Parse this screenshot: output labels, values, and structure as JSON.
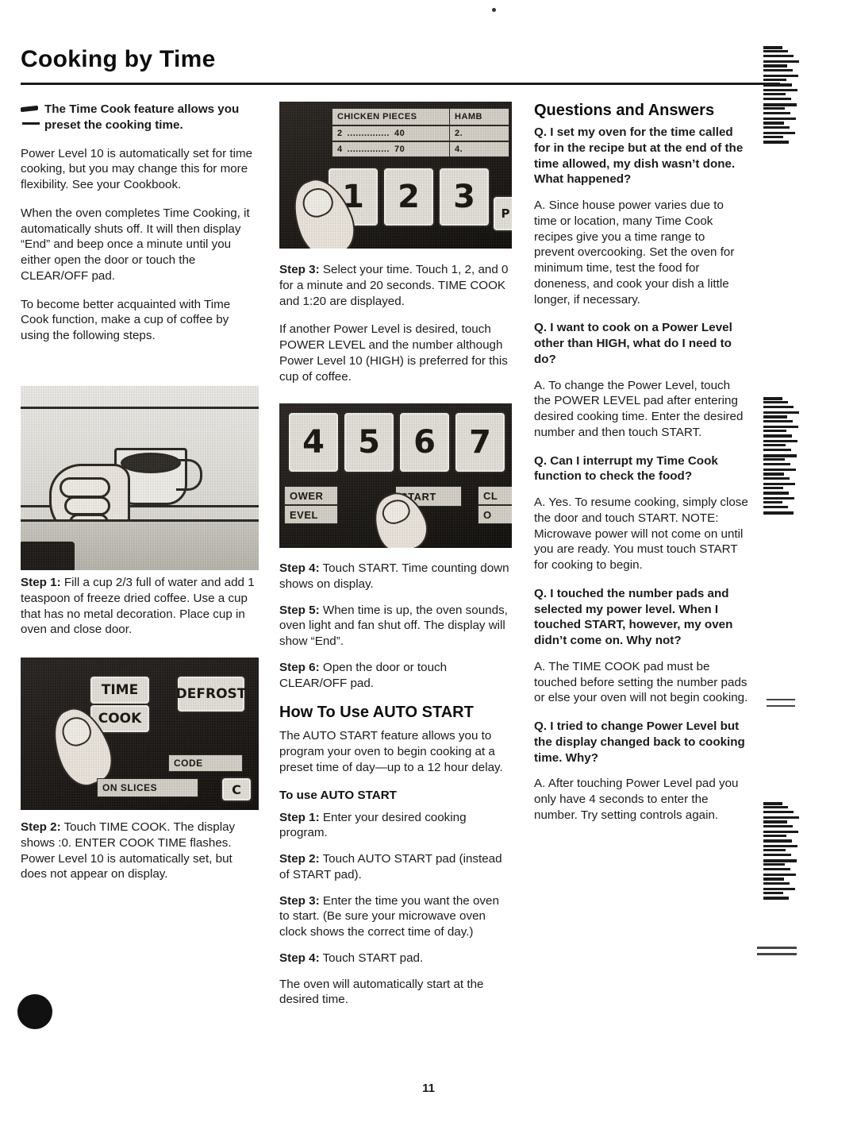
{
  "document": {
    "title": "Cooking by Time",
    "page_number": "11"
  },
  "col1": {
    "lead": "The Time Cook feature allows you preset the cooking time.",
    "p1": "Power Level 10 is automatically set for time cooking, but you may change this for more flexibility. See your Cookbook.",
    "p2": "When the oven completes Time Cooking, it automatically shuts off. It will then display “End” and beep once a minute until you either open the door or touch the CLEAR/OFF pad.",
    "p3": "To become better acquainted with Time Cook function, make a cup of coffee by using the following steps.",
    "step1_label": "Step 1:",
    "step1_text": "Fill a cup 2/3 full of water and add 1 teaspoon of freeze dried coffee. Use a cup that has no metal decoration. Place cup in oven and close door.",
    "step2_label": "Step 2:",
    "step2_text": "Touch TIME COOK. The display shows :0. ENTER COOK TIME flashes. Power Level 10 is automatically set, but does not appear on display."
  },
  "col2": {
    "step3_label": "Step 3:",
    "step3_text": "Select your time. Touch 1, 2, and 0 for a minute and 20 seconds. TIME COOK and 1:20 are displayed.",
    "p_power": "If another Power Level is desired, touch POWER LEVEL and the number although Power Level 10 (HIGH) is preferred for this cup of coffee.",
    "step4_label": "Step 4:",
    "step4_text": "Touch START. Time counting down shows on display.",
    "step5_label": "Step 5:",
    "step5_text": "When time is up, the oven sounds, oven light and fan shut off. The display will show “End”.",
    "step6_label": "Step 6:",
    "step6_text": "Open the door or touch CLEAR/OFF pad.",
    "auto_heading": "How To Use AUTO START",
    "auto_intro": "The AUTO START feature allows you to program your oven to begin cooking at a preset time of day—up to a 12 hour delay.",
    "auto_sub": "To use AUTO START",
    "a_step1_label": "Step 1:",
    "a_step1_text": "Enter your desired cooking program.",
    "a_step2_label": "Step 2:",
    "a_step2_text": "Touch AUTO START pad (instead of START pad).",
    "a_step3_label": "Step 3:",
    "a_step3_text": "Enter the time you want the oven to start. (Be sure your microwave oven clock shows the correct time of day.)",
    "a_step4_label": "Step 4:",
    "a_step4_text": "Touch START pad.",
    "auto_end": "The oven will automatically start at the desired time."
  },
  "col3": {
    "heading": "Questions and Answers",
    "q1": "Q. I set my oven for the time called for in the recipe but at the end of the time allowed, my dish wasn’t done. What happened?",
    "a1": "A. Since house power varies due to time or location, many Time Cook recipes give you a time range to prevent overcooking. Set the oven for minimum time, test the food for doneness, and cook your dish a little longer, if necessary.",
    "q2": "Q. I want to cook on a Power Level other than HIGH, what do I need to do?",
    "a2": "A. To change the Power Level, touch the POWER LEVEL pad after entering desired cooking time. Enter the desired number and then touch START.",
    "q3": "Q. Can I interrupt my Time Cook function to check the food?",
    "a3": "A. Yes. To resume cooking, simply close the door and touch START. NOTE: Microwave power will not come on until you are ready. You must touch START for cooking to begin.",
    "q4": "Q. I touched the number pads and selected my power level. When I touched START, however, my oven didn’t come on. Why not?",
    "a4": "A. The TIME COOK pad must be touched before setting the number pads or else your oven will not begin cooking.",
    "q5": "Q. I tried to change Power Level but the display changed back to cooking time. Why?",
    "a5": "A. After touching Power Level pad you only have 4 seconds to enter the number. Try setting controls again."
  },
  "photos": {
    "keypad_top": {
      "caption_left": "CHICKEN PIECES",
      "caption_right": "HAMB",
      "row1_left": "2",
      "row1_dots": "...............",
      "row1_time": "40",
      "row1_right": "2.",
      "row2_left": "4",
      "row2_dots": "...............",
      "row2_time": "70",
      "row2_right": "4.",
      "pads": [
        "1",
        "2",
        "3"
      ],
      "edge_pad": "P"
    },
    "keypad_bottom": {
      "pads": [
        "4",
        "5",
        "6",
        "7"
      ],
      "power_label_1": "OWER",
      "power_label_2": "EVEL",
      "start_label": "START",
      "right_label_1": "CL",
      "right_label_2": "O"
    },
    "panel": {
      "time_label": "TIME",
      "cook_label": "COOK",
      "defrost_label": "DEFROST",
      "code_label": "CODE",
      "slices_label": "ON SLICES",
      "corner_label": "C"
    }
  }
}
